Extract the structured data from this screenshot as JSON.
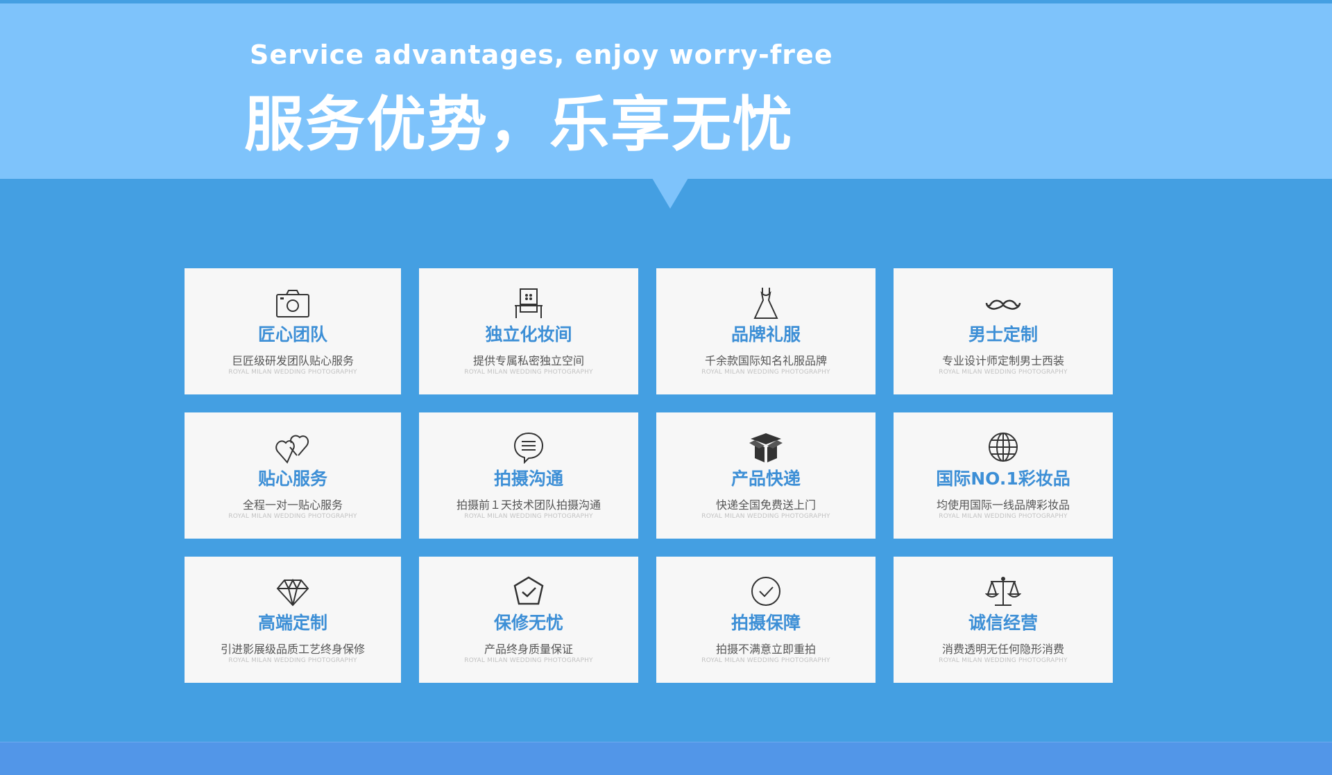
{
  "header": {
    "subtitle": "Service advantages, enjoy worry-free",
    "title": "服务优势，乐享无忧"
  },
  "colors": {
    "banner": "#7ec3fb",
    "background": "#449fe2",
    "card": "#f7f7f7",
    "card_title": "#3d8fd6",
    "footer": "#5296e8"
  },
  "cards": [
    {
      "icon": "camera-icon",
      "title": "匠心团队",
      "desc": "巨匠级研发团队贴心服务",
      "en": "ROYAL MILAN WEDDING PHOTOGRAPHY"
    },
    {
      "icon": "dressing-table-icon",
      "title": "独立化妆间",
      "desc": "提供专属私密独立空间",
      "en": "ROYAL MILAN WEDDING PHOTOGRAPHY"
    },
    {
      "icon": "dress-icon",
      "title": "品牌礼服",
      "desc": "千余款国际知名礼服品牌",
      "en": "ROYAL MILAN WEDDING PHOTOGRAPHY"
    },
    {
      "icon": "mustache-icon",
      "title": "男士定制",
      "desc": "专业设计师定制男士西装",
      "en": "ROYAL MILAN WEDDING PHOTOGRAPHY"
    },
    {
      "icon": "hearts-icon",
      "title": "贴心服务",
      "desc": "全程一对一贴心服务",
      "en": "ROYAL MILAN WEDDING PHOTOGRAPHY"
    },
    {
      "icon": "chat-bubble-icon",
      "title": "拍摄沟通",
      "desc": "拍摄前１天技术团队拍摄沟通",
      "en": "ROYAL MILAN WEDDING PHOTOGRAPHY"
    },
    {
      "icon": "box-icon",
      "title": "产品快递",
      "desc": "快递全国免费送上门",
      "en": "ROYAL MILAN WEDDING PHOTOGRAPHY"
    },
    {
      "icon": "globe-icon",
      "title": "国际NO.1彩妆品",
      "desc": "均使用国际一线品牌彩妆品",
      "en": "ROYAL MILAN WEDDING PHOTOGRAPHY"
    },
    {
      "icon": "diamond-icon",
      "title": "高端定制",
      "desc": "引进影展级品质工艺终身保修",
      "en": "ROYAL MILAN WEDDING PHOTOGRAPHY"
    },
    {
      "icon": "shield-check-icon",
      "title": "保修无忧",
      "desc": "产品终身质量保证",
      "en": "ROYAL MILAN WEDDING PHOTOGRAPHY"
    },
    {
      "icon": "check-circle-icon",
      "title": "拍摄保障",
      "desc": "拍摄不满意立即重拍",
      "en": "ROYAL MILAN WEDDING PHOTOGRAPHY"
    },
    {
      "icon": "scales-icon",
      "title": "诚信经营",
      "desc": "消费透明无任何隐形消费",
      "en": "ROYAL MILAN WEDDING PHOTOGRAPHY"
    }
  ]
}
